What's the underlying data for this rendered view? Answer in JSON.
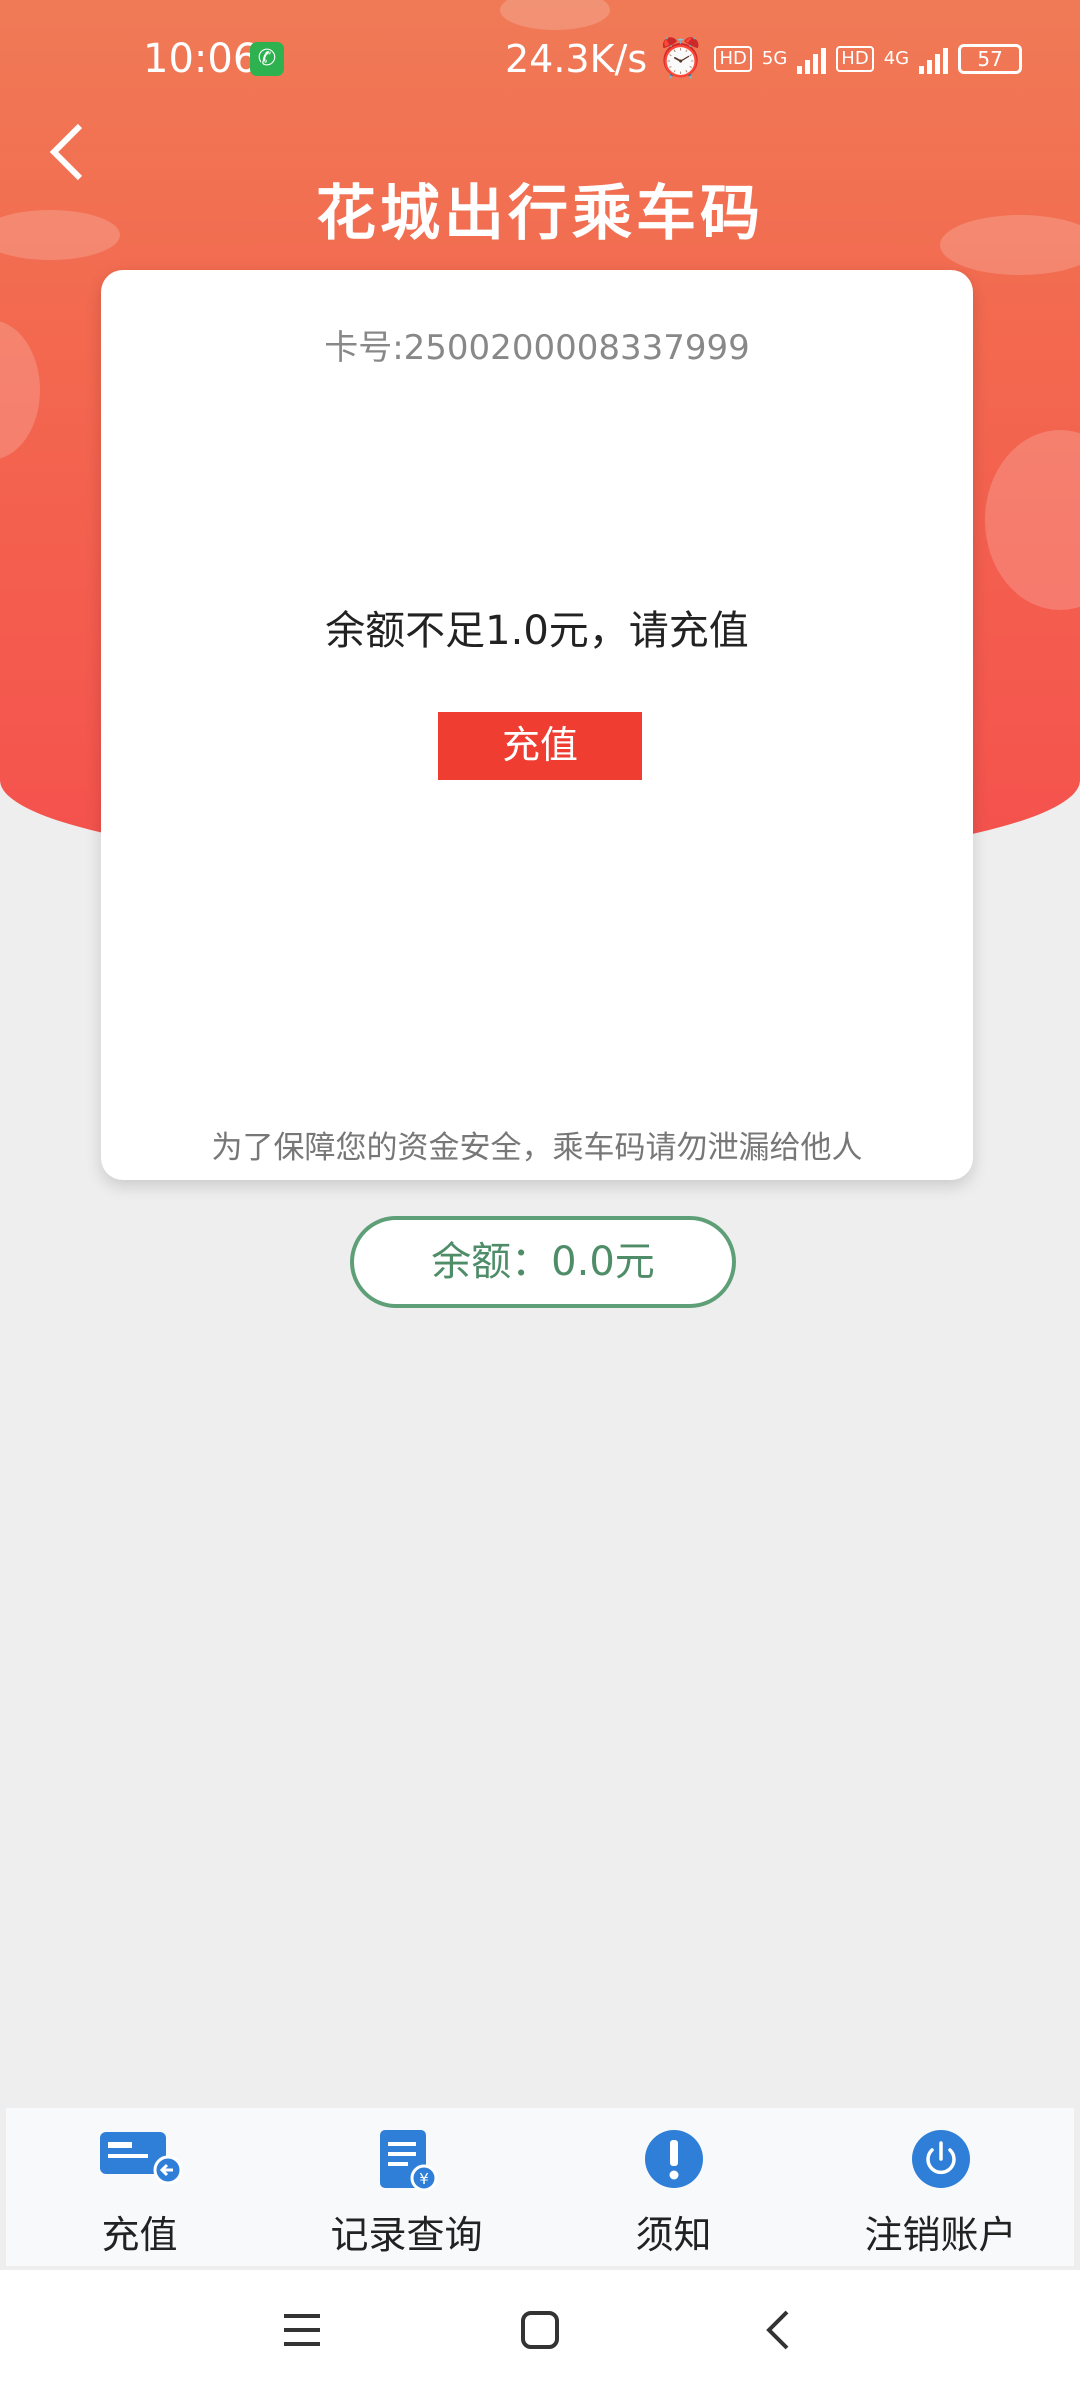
{
  "status_bar": {
    "time": "10:06",
    "network_speed": "24.3K/s",
    "hd1": "HD",
    "net1": "5G",
    "hd2": "HD",
    "net2": "4G",
    "battery": "57"
  },
  "header": {
    "title": "花城出行乘车码"
  },
  "card": {
    "card_number": "卡号:2500200008337999",
    "balance_message": "余额不足1.0元，请充值",
    "recharge_button": "充值",
    "safety_note": "为了保障您的资金安全，乘车码请勿泄漏给他人"
  },
  "balance": {
    "text": "余额：0.0元"
  },
  "bottom_nav": {
    "items": [
      {
        "label": "充值",
        "icon": "card-recharge-icon"
      },
      {
        "label": "记录查询",
        "icon": "record-query-icon"
      },
      {
        "label": "须知",
        "icon": "notice-icon"
      },
      {
        "label": "注销账户",
        "icon": "power-icon"
      }
    ]
  },
  "colors": {
    "header_top": "#f07a56",
    "header_bottom": "#f4514d",
    "recharge_button": "#ef3d31",
    "balance_green": "#5e9f78",
    "nav_icon_blue": "#2f7fd8"
  }
}
